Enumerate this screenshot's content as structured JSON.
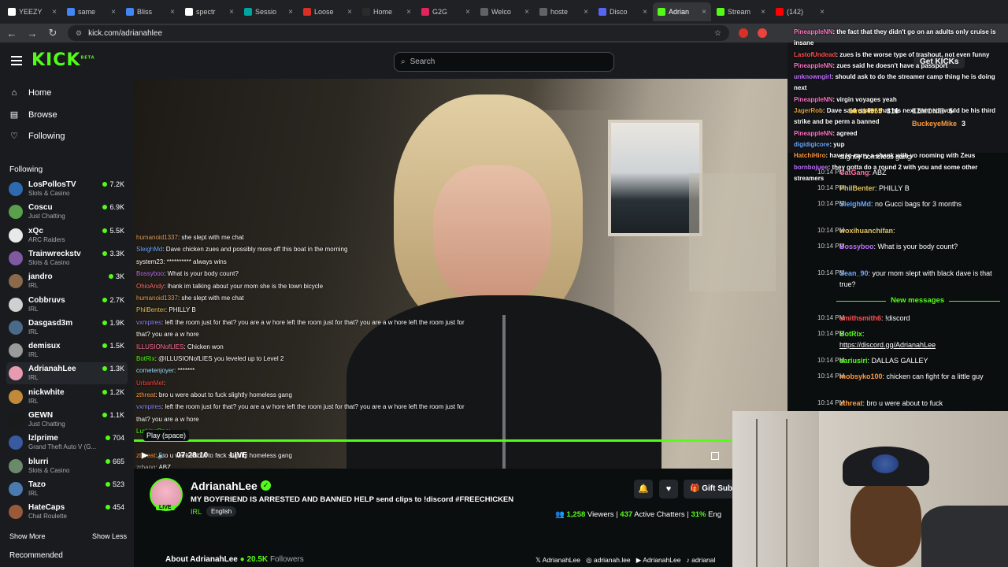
{
  "browser": {
    "tabs": [
      {
        "label": "YEEZY",
        "color": "#ffffff",
        "active": false
      },
      {
        "label": "same",
        "color": "#4285f4",
        "active": false
      },
      {
        "label": "Bliss",
        "color": "#4285f4",
        "active": false
      },
      {
        "label": "spectr",
        "color": "#ffffff",
        "active": false
      },
      {
        "label": "Sessio",
        "color": "#00a5a0",
        "active": false
      },
      {
        "label": "Loose",
        "color": "#d93025",
        "active": false
      },
      {
        "label": "Home",
        "color": "#2b2b2b",
        "active": false
      },
      {
        "label": "G2G",
        "color": "#e0245e",
        "active": false
      },
      {
        "label": "Welco",
        "color": "#5f6368",
        "active": false
      },
      {
        "label": "hoste",
        "color": "#5f6368",
        "active": false
      },
      {
        "label": "Disco",
        "color": "#5865f2",
        "active": false
      },
      {
        "label": "Adrian",
        "color": "#53fc18",
        "active": true
      },
      {
        "label": "Stream",
        "color": "#53fc18",
        "active": false
      },
      {
        "label": "(142)",
        "color": "#ff0000",
        "active": false
      }
    ],
    "url": "kick.com/adrianahlee"
  },
  "header": {
    "logo": "KICK",
    "logo_sup": "BETA",
    "search_placeholder": "Search"
  },
  "sidebar": {
    "nav": [
      {
        "label": "Home",
        "icon": "home-icon"
      },
      {
        "label": "Browse",
        "icon": "browse-icon"
      },
      {
        "label": "Following",
        "icon": "heart-icon"
      }
    ],
    "following_title": "Following",
    "channels": [
      {
        "name": "LosPollosTV",
        "category": "Slots & Casino",
        "viewers": "7.2K",
        "color": "#2d6ab0"
      },
      {
        "name": "Coscu",
        "category": "Just Chatting",
        "viewers": "6.9K",
        "color": "#5aa04a"
      },
      {
        "name": "xQc",
        "category": "ARC Raiders",
        "viewers": "5.5K",
        "color": "#e8e8e8"
      },
      {
        "name": "Trainwreckstv",
        "category": "Slots & Casino",
        "viewers": "3.3K",
        "color": "#7f5aa0"
      },
      {
        "name": "jandro",
        "category": "IRL",
        "viewers": "3K",
        "color": "#8a6a4a"
      },
      {
        "name": "Cobbruvs",
        "category": "IRL",
        "viewers": "2.7K",
        "color": "#d0d0d0"
      },
      {
        "name": "Dasgasd3m",
        "category": "IRL",
        "viewers": "1.9K",
        "color": "#4a6a8a"
      },
      {
        "name": "demisux",
        "category": "IRL",
        "viewers": "1.5K",
        "color": "#9a9a9a"
      },
      {
        "name": "AdrianahLee",
        "category": "IRL",
        "viewers": "1.3K",
        "color": "#e89ab0"
      },
      {
        "name": "nickwhite",
        "category": "IRL",
        "viewers": "1.2K",
        "color": "#c08a3a"
      },
      {
        "name": "GEWN",
        "category": "Just Chatting",
        "viewers": "1.1K",
        "color": "#1a1a1a"
      },
      {
        "name": "lzlprime",
        "category": "Grand Theft Auto V (G...",
        "viewers": "704",
        "color": "#3a5aa0"
      },
      {
        "name": "blurri",
        "category": "Slots & Casino",
        "viewers": "665",
        "color": "#6a8a6a"
      },
      {
        "name": "Tazo",
        "category": "IRL",
        "viewers": "523",
        "color": "#4a7ab0"
      },
      {
        "name": "HateCaps",
        "category": "Chat Roulette",
        "viewers": "454",
        "color": "#9a5a3a"
      }
    ],
    "show_more": "Show More",
    "show_less": "Show Less",
    "recommended": "Recommended"
  },
  "video": {
    "overlay_chat": [
      {
        "user": "humanoid1337",
        "text": ": she slept with me chat",
        "color": "#e0a060"
      },
      {
        "user": "SleighMd",
        "text": ": Dave chicken zues and possibly more off this boat in the morning",
        "color": "#6aa8ff"
      },
      {
        "user": "system23",
        "text": ": ********** always wins",
        "color": "#ffffff"
      },
      {
        "user": "Bossyboo",
        "text": ": What is your body count? ",
        "color": "#c070ff"
      },
      {
        "user": "OhioAndy",
        "text": ": lhank im talking about your mom she is the town bicycle",
        "color": "#ff7070"
      },
      {
        "user": "humanoid1337",
        "text": ": she slept with me chat",
        "color": "#e0a060"
      },
      {
        "user": "PhilBenter",
        "text": ": PHILLY B",
        "color": "#e0c060"
      },
      {
        "user": "vxmpires",
        "text": ": left the room just for that? you are a w hore left the room just for that? you are a w hore left the room just for",
        "color": "#8a8aff"
      },
      {
        "user": "",
        "text": "that? you are a w hore",
        "color": "#ffffff"
      },
      {
        "user": "ILLUSIONofLIES",
        "text": ": Chicken won",
        "color": "#ff70a0"
      },
      {
        "user": "BotRix",
        "text": ": @ILLUSIONofLIES you leveled up to Level 2",
        "color": "#53fc18"
      },
      {
        "user": "cometenjoyer",
        "text": ": *******",
        "color": "#a0e0ff"
      },
      {
        "user": "UrbanMel",
        "text": ":",
        "color": "#ff4040"
      },
      {
        "user": "zthreat",
        "text": ": bro u were about to fuck slightly homeless gang",
        "color": "#ff9a40"
      },
      {
        "user": "vxmpires",
        "text": ": left the room just for that? you are a w hore left the room just for that? you are a w hore left the room just for",
        "color": "#8a8aff"
      },
      {
        "user": "",
        "text": "that? you are a w hore",
        "color": "#ffffff"
      },
      {
        "user": "LurkingOne",
        "text": ":",
        "color": "#53fc18"
      },
      {
        "user": "",
        "text": "",
        "color": "#ffffff"
      },
      {
        "user": "zthreat",
        "text": ": bro u were about to fuck slightly homeless gang",
        "color": "#ff9a40"
      },
      {
        "user": "zrbang",
        "text": ": ABZ",
        "color": "#aaaaaa"
      }
    ],
    "tooltip": "Play (space)",
    "time": "07:28:10",
    "live": "LIVE",
    "progress_fraction": 0.918
  },
  "stream": {
    "name": "AdrianahLee",
    "title": "MY BOYFRIEND IS ARRESTED AND BANNED HELP send clips to !discord #FREECHICKEN",
    "category": "IRL",
    "language": "English",
    "live_badge": "LIVE",
    "gift_label": "Gift Sub",
    "viewers": "1,258",
    "viewers_label": "Viewers",
    "chatters": "437",
    "chatters_label": "Active Chatters",
    "engagement": "31%",
    "engagement_label": "Eng",
    "about": "About AdrianahLee",
    "followers": "20.5K",
    "followers_label": "Followers",
    "socials": [
      "AdrianahLee",
      "adrianah.lee",
      "AdrianahLee",
      "adrianal"
    ]
  },
  "chat": {
    "get_kicks": "Get KICKs",
    "overlay": [
      {
        "user": "PineappleNN",
        "text": ": the fact that they didn't go on an adults only cruise is insane",
        "color": "#ff70c0"
      },
      {
        "user": "LastofUndead",
        "text": ": zues is the worse type of trashout, not even funny",
        "color": "#ff5050"
      },
      {
        "user": "PineappleNN",
        "text": ": zues said he doesn't have a passport",
        "color": "#ff70c0"
      },
      {
        "user": "unknowngirl",
        "text": ": should ask to do the streamer camp thing he is doing next",
        "color": "#c070ff"
      },
      {
        "user": "PineappleNN",
        "text": ": virgin voyages yeah",
        "color": "#ff70c0"
      },
      {
        "user": "JagerRob",
        "text": ": Dave said earlier that his next banned would be his third strike and be perm a banned",
        "color": "#e0a040"
      },
      {
        "user": "PineappleNN",
        "text": ": agreed",
        "color": "#ff70c0"
      },
      {
        "user": "digidigicore",
        "text": ": yup",
        "color": "#6aa8ff"
      },
      {
        "user": "HatchiHiro",
        "text": ": have to carry a shank with yo rooming with Zeus",
        "color": "#ff9a40"
      },
      {
        "user": "bornbojuee",
        "text": ": they gotta do a round 2 with you and some other streamers",
        "color": "#c070ff"
      }
    ],
    "top_gifters": [
      {
        "name": "bird14555",
        "count": "316",
        "color": "#ffd24a"
      },
      {
        "name": "EZMONIE",
        "count": "5",
        "color": "#d0d0d0"
      },
      {
        "name": "BuckeyeMike",
        "count": "3",
        "color": "#ff9a40"
      }
    ],
    "messages": [
      {
        "time": "",
        "user": "",
        "text": "slightly homeless gang",
        "color": "#ffffff"
      },
      {
        "time": "10:14 PM",
        "user": "CatGang",
        "text": ": ABZ",
        "color": "#ff70a0"
      },
      {
        "time": "10:14 PM",
        "user": "PhilBenter",
        "text": ": PHILLY B",
        "color": "#e0c060"
      },
      {
        "time": "10:14 PM",
        "user": "SleighMd",
        "text": ": no Gucci bags for 3 months",
        "color": "#6aa8ff"
      },
      {
        "time": "10:14 PM",
        "user": "woxihuanchifan",
        "text": ":",
        "color": "#e0c060"
      },
      {
        "time": "10:14 PM",
        "user": "Bossyboo",
        "text": ": What is your body count?",
        "color": "#c070ff"
      },
      {
        "time": "10:14 PM",
        "user": "Sean_90",
        "text": ": your mom slept with black dave is that true?",
        "color": "#6aa8ff"
      }
    ],
    "new_messages": "New messages",
    "new": [
      {
        "time": "10:14 PM",
        "user": "smithsmith6",
        "text": ": !discord",
        "color": "#ff5050"
      },
      {
        "time": "10:14 PM",
        "user": "BotRix",
        "text": ":",
        "color": "#53fc18"
      },
      {
        "time": "",
        "user": "",
        "text": "https://discord.gg/AdrianahLee",
        "color": "#ffffff"
      },
      {
        "time": "10:14 PM",
        "user": "dariusiri",
        "text": ": DALLAS GALLEY",
        "color": "#53fc18"
      },
      {
        "time": "10:14 PM",
        "user": "mobsyko100",
        "text": ": chicken can fight for a little guy",
        "color": "#ff9a40"
      },
      {
        "time": "10:14 PM",
        "user": "zthreat",
        "text": ": bro u were about to fuck",
        "color": "#ff9a40"
      }
    ]
  }
}
